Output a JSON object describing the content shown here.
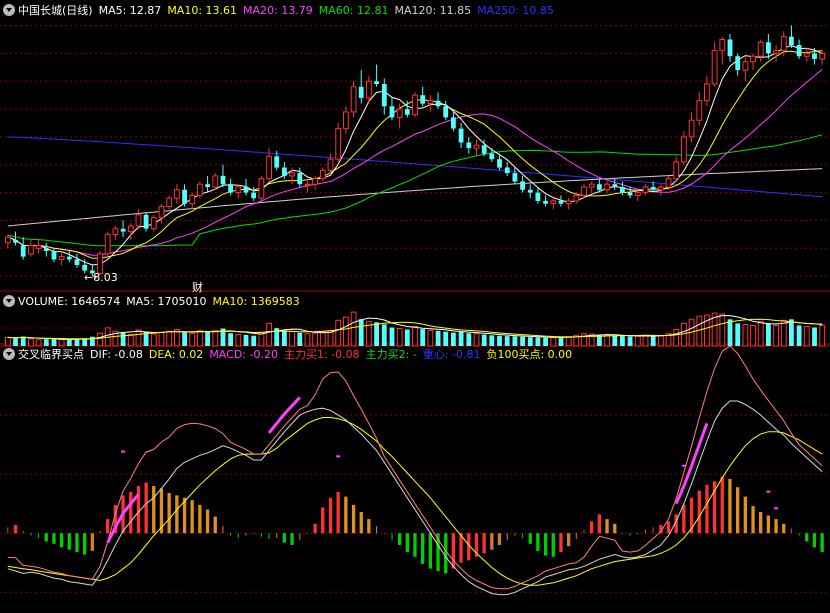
{
  "colors": {
    "background": "#000000",
    "up": "#ff3232",
    "down": "#54ffff",
    "ma5": "#ffffff",
    "ma10": "#ffff00",
    "ma20": "#ff40ff",
    "ma60": "#00e000",
    "ma120": "#d0d0d0",
    "ma250": "#3030ff",
    "grid": "#8b0000",
    "separator": "#b00000",
    "dif": "#ffffff",
    "dea": "#ffff00",
    "macd": "#ff40ff",
    "zhuli1": "#ff3232",
    "zhuli2": "#00e000",
    "zhongxin": "#3030ff",
    "fu100": "#ffff00"
  },
  "price_panel": {
    "stock_name": "中国长城(日线)",
    "ma_legend": [
      {
        "label": "MA5: 12.87",
        "key": "ma5"
      },
      {
        "label": "MA10: 13.61",
        "key": "ma10"
      },
      {
        "label": "MA20: 13.79",
        "key": "ma20"
      },
      {
        "label": "MA60: 12.81",
        "key": "ma60"
      },
      {
        "label": "MA120: 11.85",
        "key": "ma120"
      },
      {
        "label": "MA250: 10.85",
        "key": "ma250"
      }
    ],
    "low_annotation": "←8.03",
    "cai_annotation": "财"
  },
  "volume_panel": {
    "legend": [
      {
        "label": "VOLUME: 1646574",
        "key": "ma5"
      },
      {
        "label": "MA5: 1705010",
        "key": "ma5"
      },
      {
        "label": "MA10: 1369583",
        "key": "ma10"
      }
    ]
  },
  "macd_panel": {
    "indicator_name": "交叉临界买点",
    "legend": [
      {
        "label": "DIF: -0.08",
        "key": "dif"
      },
      {
        "label": "DEA: 0.02",
        "key": "dea"
      },
      {
        "label": "MACD: -0.20",
        "key": "macd"
      },
      {
        "label": "主力买1: -0.08",
        "key": "zhuli1"
      },
      {
        "label": "主力买2: -",
        "key": "zhuli2"
      },
      {
        "label": "重心: -0.81",
        "key": "zhongxin"
      },
      {
        "label": "负100买点: 0.00",
        "key": "fu100"
      }
    ]
  },
  "chart_data": {
    "type": "candlestick",
    "ylim": [
      7.5,
      17.2
    ],
    "low_marker": 8.03,
    "ohlc": [
      [
        9.2,
        9.5,
        9.0,
        9.4
      ],
      [
        9.3,
        9.6,
        9.1,
        9.2
      ],
      [
        9.1,
        9.4,
        8.6,
        8.7
      ],
      [
        8.8,
        9.3,
        8.7,
        9.1
      ],
      [
        9.0,
        9.3,
        8.8,
        9.1
      ],
      [
        9.0,
        9.2,
        8.7,
        8.9
      ],
      [
        8.9,
        9.0,
        8.5,
        8.6
      ],
      [
        8.6,
        8.9,
        8.4,
        8.7
      ],
      [
        8.7,
        8.9,
        8.5,
        8.6
      ],
      [
        8.6,
        8.8,
        8.3,
        8.4
      ],
      [
        8.4,
        8.6,
        8.1,
        8.2
      ],
      [
        8.2,
        8.4,
        8.03,
        8.1
      ],
      [
        8.1,
        8.9,
        8.03,
        8.8
      ],
      [
        8.8,
        9.6,
        8.7,
        9.5
      ],
      [
        9.5,
        9.8,
        9.3,
        9.7
      ],
      [
        9.7,
        10.0,
        9.4,
        9.6
      ],
      [
        9.6,
        9.9,
        9.3,
        9.8
      ],
      [
        9.8,
        10.4,
        9.7,
        10.2
      ],
      [
        10.2,
        10.3,
        9.6,
        9.7
      ],
      [
        9.7,
        10.2,
        9.6,
        10.1
      ],
      [
        10.1,
        10.6,
        9.9,
        10.5
      ],
      [
        10.5,
        10.9,
        10.4,
        10.8
      ],
      [
        10.8,
        11.3,
        10.6,
        11.1
      ],
      [
        11.1,
        11.3,
        10.5,
        10.6
      ],
      [
        10.6,
        11.0,
        10.4,
        10.9
      ],
      [
        10.9,
        11.4,
        10.8,
        11.3
      ],
      [
        11.3,
        11.6,
        11.0,
        11.2
      ],
      [
        11.2,
        11.7,
        11.1,
        11.6
      ],
      [
        11.6,
        12.0,
        11.2,
        11.3
      ],
      [
        11.3,
        11.5,
        10.9,
        11.0
      ],
      [
        11.0,
        11.3,
        10.8,
        11.2
      ],
      [
        11.2,
        11.5,
        10.9,
        11.0
      ],
      [
        11.0,
        11.2,
        10.7,
        10.8
      ],
      [
        10.8,
        11.6,
        10.7,
        11.5
      ],
      [
        11.5,
        12.6,
        11.4,
        12.3
      ],
      [
        12.3,
        12.5,
        11.8,
        11.9
      ],
      [
        11.9,
        12.1,
        11.5,
        11.6
      ],
      [
        11.6,
        11.9,
        11.3,
        11.7
      ],
      [
        11.7,
        11.9,
        11.2,
        11.3
      ],
      [
        11.3,
        11.5,
        11.0,
        11.3
      ],
      [
        11.3,
        11.6,
        11.1,
        11.5
      ],
      [
        11.5,
        11.9,
        11.4,
        11.8
      ],
      [
        11.8,
        12.4,
        11.7,
        12.2
      ],
      [
        12.2,
        13.5,
        12.1,
        13.3
      ],
      [
        13.3,
        14.1,
        13.1,
        13.9
      ],
      [
        13.9,
        15.0,
        13.7,
        14.8
      ],
      [
        14.8,
        15.4,
        14.2,
        14.4
      ],
      [
        14.4,
        15.2,
        14.2,
        15.0
      ],
      [
        15.0,
        15.6,
        14.8,
        14.9
      ],
      [
        14.9,
        15.1,
        13.8,
        14.1
      ],
      [
        14.1,
        14.4,
        13.6,
        13.7
      ],
      [
        13.7,
        14.2,
        13.3,
        14.0
      ],
      [
        14.0,
        14.3,
        13.7,
        13.8
      ],
      [
        13.8,
        14.6,
        13.7,
        14.5
      ],
      [
        14.5,
        14.8,
        14.1,
        14.2
      ],
      [
        14.2,
        14.5,
        13.9,
        14.3
      ],
      [
        14.3,
        14.6,
        14.0,
        14.1
      ],
      [
        14.1,
        14.3,
        13.6,
        13.7
      ],
      [
        13.7,
        14.0,
        13.2,
        13.3
      ],
      [
        13.3,
        13.5,
        12.6,
        12.8
      ],
      [
        12.8,
        13.0,
        12.4,
        12.6
      ],
      [
        12.6,
        12.9,
        12.3,
        12.7
      ],
      [
        12.7,
        12.9,
        12.3,
        12.4
      ],
      [
        12.4,
        12.6,
        12.1,
        12.2
      ],
      [
        12.2,
        12.4,
        11.8,
        11.9
      ],
      [
        11.9,
        12.1,
        11.6,
        11.7
      ],
      [
        11.7,
        11.9,
        11.3,
        11.4
      ],
      [
        11.4,
        11.6,
        11.0,
        11.1
      ],
      [
        11.1,
        11.3,
        10.8,
        11.0
      ],
      [
        11.0,
        11.2,
        10.6,
        10.7
      ],
      [
        10.7,
        10.9,
        10.5,
        10.6
      ],
      [
        10.6,
        10.8,
        10.4,
        10.7
      ],
      [
        10.7,
        10.9,
        10.5,
        10.6
      ],
      [
        10.6,
        10.8,
        10.4,
        10.7
      ],
      [
        10.7,
        11.0,
        10.6,
        10.9
      ],
      [
        10.9,
        11.3,
        10.8,
        11.2
      ],
      [
        11.2,
        11.4,
        11.0,
        11.3
      ],
      [
        11.3,
        11.5,
        11.0,
        11.1
      ],
      [
        11.1,
        11.4,
        11.0,
        11.3
      ],
      [
        11.3,
        11.5,
        11.1,
        11.2
      ],
      [
        11.2,
        11.4,
        10.9,
        11.0
      ],
      [
        11.0,
        11.2,
        10.8,
        10.9
      ],
      [
        10.9,
        11.1,
        10.7,
        11.0
      ],
      [
        11.0,
        11.3,
        10.9,
        11.2
      ],
      [
        11.2,
        11.4,
        11.0,
        11.1
      ],
      [
        11.1,
        11.3,
        10.9,
        11.2
      ],
      [
        11.2,
        11.6,
        11.1,
        11.5
      ],
      [
        11.5,
        12.3,
        11.4,
        12.1
      ],
      [
        12.1,
        13.2,
        12.0,
        13.0
      ],
      [
        13.0,
        13.9,
        12.8,
        13.6
      ],
      [
        13.6,
        14.6,
        13.4,
        14.3
      ],
      [
        14.3,
        15.2,
        14.1,
        14.9
      ],
      [
        14.9,
        16.4,
        14.8,
        16.1
      ],
      [
        16.1,
        16.6,
        15.6,
        16.5
      ],
      [
        16.5,
        16.7,
        15.7,
        15.9
      ],
      [
        15.9,
        16.0,
        15.2,
        15.4
      ],
      [
        15.4,
        15.9,
        15.0,
        15.7
      ],
      [
        15.7,
        16.0,
        15.4,
        15.9
      ],
      [
        15.9,
        16.5,
        15.7,
        16.4
      ],
      [
        16.4,
        16.7,
        15.8,
        16.0
      ],
      [
        16.0,
        16.3,
        15.7,
        16.1
      ],
      [
        16.1,
        16.8,
        15.9,
        16.6
      ],
      [
        16.6,
        17.0,
        16.2,
        16.3
      ],
      [
        16.3,
        16.5,
        15.8,
        15.9
      ],
      [
        15.9,
        16.2,
        15.7,
        16.0
      ],
      [
        16.0,
        16.2,
        15.6,
        15.8
      ],
      [
        15.8,
        16.1,
        15.6,
        16.0
      ]
    ],
    "volume": [
      420,
      380,
      460,
      350,
      300,
      330,
      360,
      310,
      290,
      330,
      380,
      450,
      620,
      880,
      720,
      640,
      560,
      780,
      700,
      590,
      660,
      720,
      800,
      690,
      610,
      740,
      690,
      760,
      850,
      620,
      560,
      540,
      500,
      680,
      1100,
      870,
      760,
      700,
      640,
      600,
      620,
      680,
      760,
      1250,
      1400,
      1650,
      1300,
      1180,
      1150,
      1050,
      900,
      850,
      800,
      950,
      820,
      760,
      740,
      700,
      650,
      680,
      620,
      600,
      560,
      520,
      500,
      480,
      470,
      450,
      430,
      420,
      400,
      410,
      430,
      450,
      520,
      600,
      580,
      520,
      540,
      500,
      480,
      460,
      470,
      520,
      500,
      510,
      600,
      800,
      1100,
      1300,
      1450,
      1500,
      1600,
      1550,
      1300,
      1100,
      1050,
      1000,
      1200,
      1100,
      1000,
      1250,
      1300,
      1000,
      950,
      900,
      1000
    ],
    "volume_ylim": [
      0,
      1750
    ],
    "histogram": [
      0.05,
      0.07,
      0.02,
      -0.02,
      -0.04,
      -0.07,
      -0.09,
      -0.12,
      -0.14,
      -0.16,
      -0.18,
      -0.15,
      0.02,
      0.12,
      0.24,
      0.32,
      0.35,
      0.4,
      0.43,
      0.4,
      0.38,
      0.34,
      0.32,
      0.3,
      0.28,
      0.24,
      0.2,
      0.14,
      0.06,
      -0.02,
      -0.04,
      -0.02,
      0.0,
      -0.03,
      -0.05,
      -0.04,
      -0.08,
      -0.1,
      -0.06,
      0.0,
      0.08,
      0.22,
      0.3,
      0.35,
      0.31,
      0.24,
      0.18,
      0.12,
      0.06,
      0.0,
      -0.06,
      -0.1,
      -0.16,
      -0.2,
      -0.26,
      -0.3,
      -0.32,
      -0.34,
      -0.3,
      -0.25,
      -0.23,
      -0.2,
      -0.17,
      -0.14,
      -0.1,
      -0.06,
      -0.02,
      -0.04,
      -0.09,
      -0.15,
      -0.19,
      -0.2,
      -0.16,
      -0.11,
      -0.05,
      0.03,
      0.1,
      0.16,
      0.12,
      0.08,
      0.0,
      -0.02,
      -0.01,
      0.03,
      0.05,
      0.07,
      0.1,
      0.16,
      0.24,
      0.3,
      0.36,
      0.41,
      0.44,
      0.48,
      0.46,
      0.39,
      0.31,
      0.23,
      0.18,
      0.15,
      0.12,
      0.08,
      0.04,
      -0.02,
      -0.07,
      -0.12,
      -0.16
    ],
    "dif": [
      -0.3,
      -0.32,
      -0.34,
      -0.33,
      -0.34,
      -0.36,
      -0.38,
      -0.39,
      -0.41,
      -0.42,
      -0.43,
      -0.44,
      -0.35,
      -0.23,
      -0.1,
      0.02,
      0.1,
      0.18,
      0.25,
      0.3,
      0.38,
      0.46,
      0.55,
      0.6,
      0.63,
      0.66,
      0.68,
      0.71,
      0.74,
      0.72,
      0.69,
      0.66,
      0.62,
      0.62,
      0.7,
      0.78,
      0.86,
      0.93,
      1.0,
      1.03,
      1.05,
      1.06,
      1.04,
      1.0,
      0.96,
      0.9,
      0.84,
      0.77,
      0.7,
      0.6,
      0.5,
      0.4,
      0.3,
      0.2,
      0.1,
      0.0,
      -0.1,
      -0.2,
      -0.28,
      -0.35,
      -0.41,
      -0.45,
      -0.48,
      -0.51,
      -0.52,
      -0.52,
      -0.5,
      -0.47,
      -0.44,
      -0.41,
      -0.37,
      -0.35,
      -0.33,
      -0.31,
      -0.3,
      -0.28,
      -0.25,
      -0.22,
      -0.2,
      -0.18,
      -0.2,
      -0.21,
      -0.2,
      -0.18,
      -0.14,
      -0.1,
      -0.02,
      0.1,
      0.25,
      0.42,
      0.6,
      0.78,
      0.95,
      1.06,
      1.12,
      1.12,
      1.09,
      1.05,
      1.0,
      0.94,
      0.88,
      0.83,
      0.76,
      0.7,
      0.64,
      0.58,
      0.52
    ],
    "dea": [
      -0.28,
      -0.29,
      -0.3,
      -0.31,
      -0.32,
      -0.33,
      -0.34,
      -0.35,
      -0.36,
      -0.37,
      -0.38,
      -0.39,
      -0.4,
      -0.38,
      -0.35,
      -0.3,
      -0.25,
      -0.18,
      -0.1,
      -0.02,
      0.05,
      0.12,
      0.2,
      0.27,
      0.34,
      0.41,
      0.47,
      0.53,
      0.58,
      0.63,
      0.66,
      0.67,
      0.67,
      0.67,
      0.68,
      0.72,
      0.78,
      0.83,
      0.88,
      0.93,
      0.96,
      0.98,
      0.98,
      0.97,
      0.95,
      0.92,
      0.88,
      0.83,
      0.78,
      0.71,
      0.65,
      0.58,
      0.51,
      0.44,
      0.37,
      0.3,
      0.22,
      0.14,
      0.06,
      -0.02,
      -0.1,
      -0.17,
      -0.23,
      -0.29,
      -0.34,
      -0.38,
      -0.41,
      -0.43,
      -0.44,
      -0.44,
      -0.43,
      -0.42,
      -0.4,
      -0.38,
      -0.36,
      -0.33,
      -0.3,
      -0.28,
      -0.26,
      -0.24,
      -0.23,
      -0.22,
      -0.21,
      -0.2,
      -0.19,
      -0.17,
      -0.14,
      -0.1,
      -0.04,
      0.04,
      0.14,
      0.25,
      0.36,
      0.47,
      0.57,
      0.66,
      0.74,
      0.8,
      0.84,
      0.86,
      0.86,
      0.85,
      0.82,
      0.79,
      0.75,
      0.71,
      0.67
    ],
    "macd_ylim": [
      -0.65,
      1.45
    ],
    "buy_marks": [
      13,
      34,
      87
    ],
    "upper_dots": [
      [
        15,
        0.7
      ],
      [
        43,
        0.66
      ],
      [
        88,
        0.58
      ],
      [
        99,
        0.36
      ],
      [
        100,
        0.22
      ]
    ]
  }
}
